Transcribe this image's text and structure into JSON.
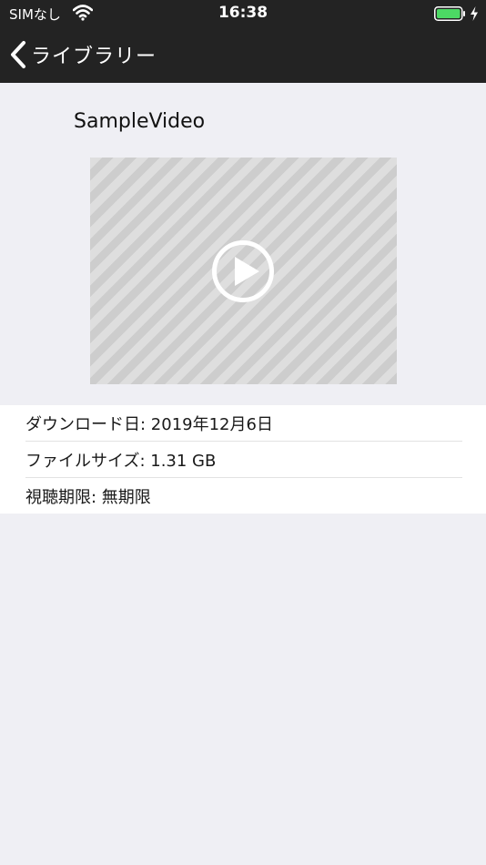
{
  "status_bar": {
    "carrier": "SIMなし",
    "time": "16:38",
    "battery_color": "#4cd964"
  },
  "nav": {
    "back_label": "ライブラリー"
  },
  "video": {
    "title": "SampleVideo",
    "play_icon": "play-circle-icon"
  },
  "info": {
    "download_date": "ダウンロード日: 2019年12月6日",
    "file_size": "ファイルサイズ: 1.31 GB",
    "viewing_period": "視聴期限: 無期限"
  }
}
